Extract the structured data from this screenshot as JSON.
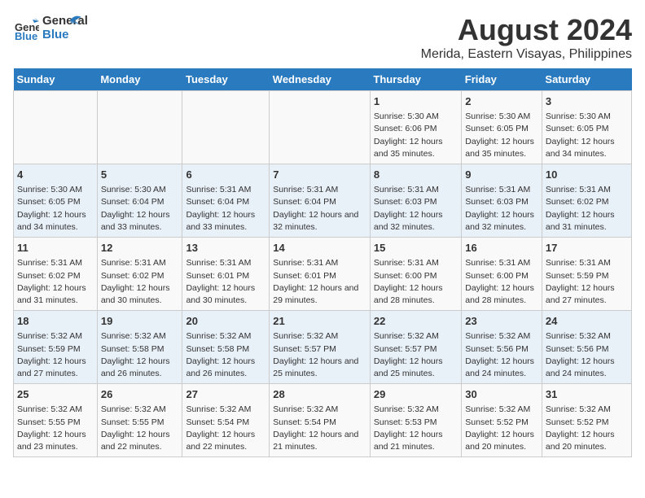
{
  "logo": {
    "part1": "General",
    "part2": "Blue"
  },
  "title": "August 2024",
  "subtitle": "Merida, Eastern Visayas, Philippines",
  "days_of_week": [
    "Sunday",
    "Monday",
    "Tuesday",
    "Wednesday",
    "Thursday",
    "Friday",
    "Saturday"
  ],
  "weeks": [
    [
      {
        "day": "",
        "content": ""
      },
      {
        "day": "",
        "content": ""
      },
      {
        "day": "",
        "content": ""
      },
      {
        "day": "",
        "content": ""
      },
      {
        "day": "1",
        "content": "Sunrise: 5:30 AM\nSunset: 6:06 PM\nDaylight: 12 hours\nand 35 minutes."
      },
      {
        "day": "2",
        "content": "Sunrise: 5:30 AM\nSunset: 6:05 PM\nDaylight: 12 hours\nand 35 minutes."
      },
      {
        "day": "3",
        "content": "Sunrise: 5:30 AM\nSunset: 6:05 PM\nDaylight: 12 hours\nand 34 minutes."
      }
    ],
    [
      {
        "day": "4",
        "content": "Sunrise: 5:30 AM\nSunset: 6:05 PM\nDaylight: 12 hours\nand 34 minutes."
      },
      {
        "day": "5",
        "content": "Sunrise: 5:30 AM\nSunset: 6:04 PM\nDaylight: 12 hours\nand 33 minutes."
      },
      {
        "day": "6",
        "content": "Sunrise: 5:31 AM\nSunset: 6:04 PM\nDaylight: 12 hours\nand 33 minutes."
      },
      {
        "day": "7",
        "content": "Sunrise: 5:31 AM\nSunset: 6:04 PM\nDaylight: 12 hours\nand 32 minutes."
      },
      {
        "day": "8",
        "content": "Sunrise: 5:31 AM\nSunset: 6:03 PM\nDaylight: 12 hours\nand 32 minutes."
      },
      {
        "day": "9",
        "content": "Sunrise: 5:31 AM\nSunset: 6:03 PM\nDaylight: 12 hours\nand 32 minutes."
      },
      {
        "day": "10",
        "content": "Sunrise: 5:31 AM\nSunset: 6:02 PM\nDaylight: 12 hours\nand 31 minutes."
      }
    ],
    [
      {
        "day": "11",
        "content": "Sunrise: 5:31 AM\nSunset: 6:02 PM\nDaylight: 12 hours\nand 31 minutes."
      },
      {
        "day": "12",
        "content": "Sunrise: 5:31 AM\nSunset: 6:02 PM\nDaylight: 12 hours\nand 30 minutes."
      },
      {
        "day": "13",
        "content": "Sunrise: 5:31 AM\nSunset: 6:01 PM\nDaylight: 12 hours\nand 30 minutes."
      },
      {
        "day": "14",
        "content": "Sunrise: 5:31 AM\nSunset: 6:01 PM\nDaylight: 12 hours\nand 29 minutes."
      },
      {
        "day": "15",
        "content": "Sunrise: 5:31 AM\nSunset: 6:00 PM\nDaylight: 12 hours\nand 28 minutes."
      },
      {
        "day": "16",
        "content": "Sunrise: 5:31 AM\nSunset: 6:00 PM\nDaylight: 12 hours\nand 28 minutes."
      },
      {
        "day": "17",
        "content": "Sunrise: 5:31 AM\nSunset: 5:59 PM\nDaylight: 12 hours\nand 27 minutes."
      }
    ],
    [
      {
        "day": "18",
        "content": "Sunrise: 5:32 AM\nSunset: 5:59 PM\nDaylight: 12 hours\nand 27 minutes."
      },
      {
        "day": "19",
        "content": "Sunrise: 5:32 AM\nSunset: 5:58 PM\nDaylight: 12 hours\nand 26 minutes."
      },
      {
        "day": "20",
        "content": "Sunrise: 5:32 AM\nSunset: 5:58 PM\nDaylight: 12 hours\nand 26 minutes."
      },
      {
        "day": "21",
        "content": "Sunrise: 5:32 AM\nSunset: 5:57 PM\nDaylight: 12 hours\nand 25 minutes."
      },
      {
        "day": "22",
        "content": "Sunrise: 5:32 AM\nSunset: 5:57 PM\nDaylight: 12 hours\nand 25 minutes."
      },
      {
        "day": "23",
        "content": "Sunrise: 5:32 AM\nSunset: 5:56 PM\nDaylight: 12 hours\nand 24 minutes."
      },
      {
        "day": "24",
        "content": "Sunrise: 5:32 AM\nSunset: 5:56 PM\nDaylight: 12 hours\nand 24 minutes."
      }
    ],
    [
      {
        "day": "25",
        "content": "Sunrise: 5:32 AM\nSunset: 5:55 PM\nDaylight: 12 hours\nand 23 minutes."
      },
      {
        "day": "26",
        "content": "Sunrise: 5:32 AM\nSunset: 5:55 PM\nDaylight: 12 hours\nand 22 minutes."
      },
      {
        "day": "27",
        "content": "Sunrise: 5:32 AM\nSunset: 5:54 PM\nDaylight: 12 hours\nand 22 minutes."
      },
      {
        "day": "28",
        "content": "Sunrise: 5:32 AM\nSunset: 5:54 PM\nDaylight: 12 hours\nand 21 minutes."
      },
      {
        "day": "29",
        "content": "Sunrise: 5:32 AM\nSunset: 5:53 PM\nDaylight: 12 hours\nand 21 minutes."
      },
      {
        "day": "30",
        "content": "Sunrise: 5:32 AM\nSunset: 5:52 PM\nDaylight: 12 hours\nand 20 minutes."
      },
      {
        "day": "31",
        "content": "Sunrise: 5:32 AM\nSunset: 5:52 PM\nDaylight: 12 hours\nand 20 minutes."
      }
    ]
  ]
}
